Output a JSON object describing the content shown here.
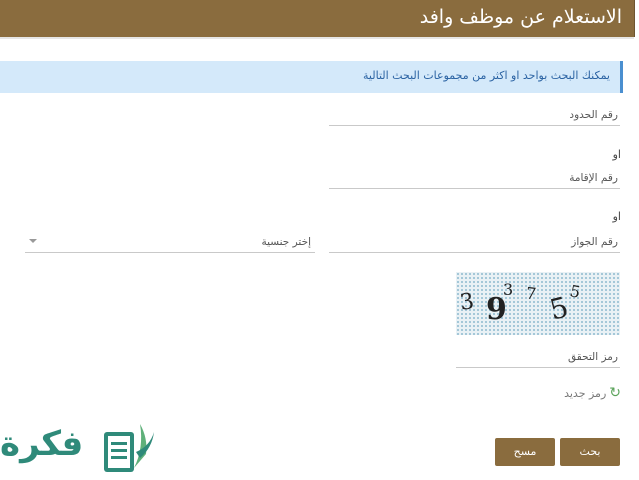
{
  "header": {
    "title": "الاستعلام عن موظف وافد"
  },
  "info": {
    "text": "يمكنك البحث بواحد او اكثر من مجموعات البحث التالية"
  },
  "form": {
    "border_number_label": "رقم الحدود",
    "or_1": "او",
    "iqama_number_label": "رقم الإقامة",
    "or_2": "او",
    "passport_number_label": "رقم الجواز",
    "nationality_placeholder": "إختر جنسية",
    "captcha_label": "رمز التحقق",
    "captcha_chars": [
      "3",
      "9",
      "3",
      "7",
      "5",
      "5"
    ],
    "new_code_label": "رمز جديد"
  },
  "buttons": {
    "search": "بحث",
    "clear": "مسح"
  },
  "logo": {
    "text": "فكرة"
  },
  "colors": {
    "brand": "#8a6c3e",
    "info_bg": "#d4e9fa",
    "info_text": "#2b63a3",
    "logo": "#2f8a7a"
  },
  "icons": {
    "refresh": "refresh-icon",
    "dropdown": "chevron-down-icon"
  }
}
